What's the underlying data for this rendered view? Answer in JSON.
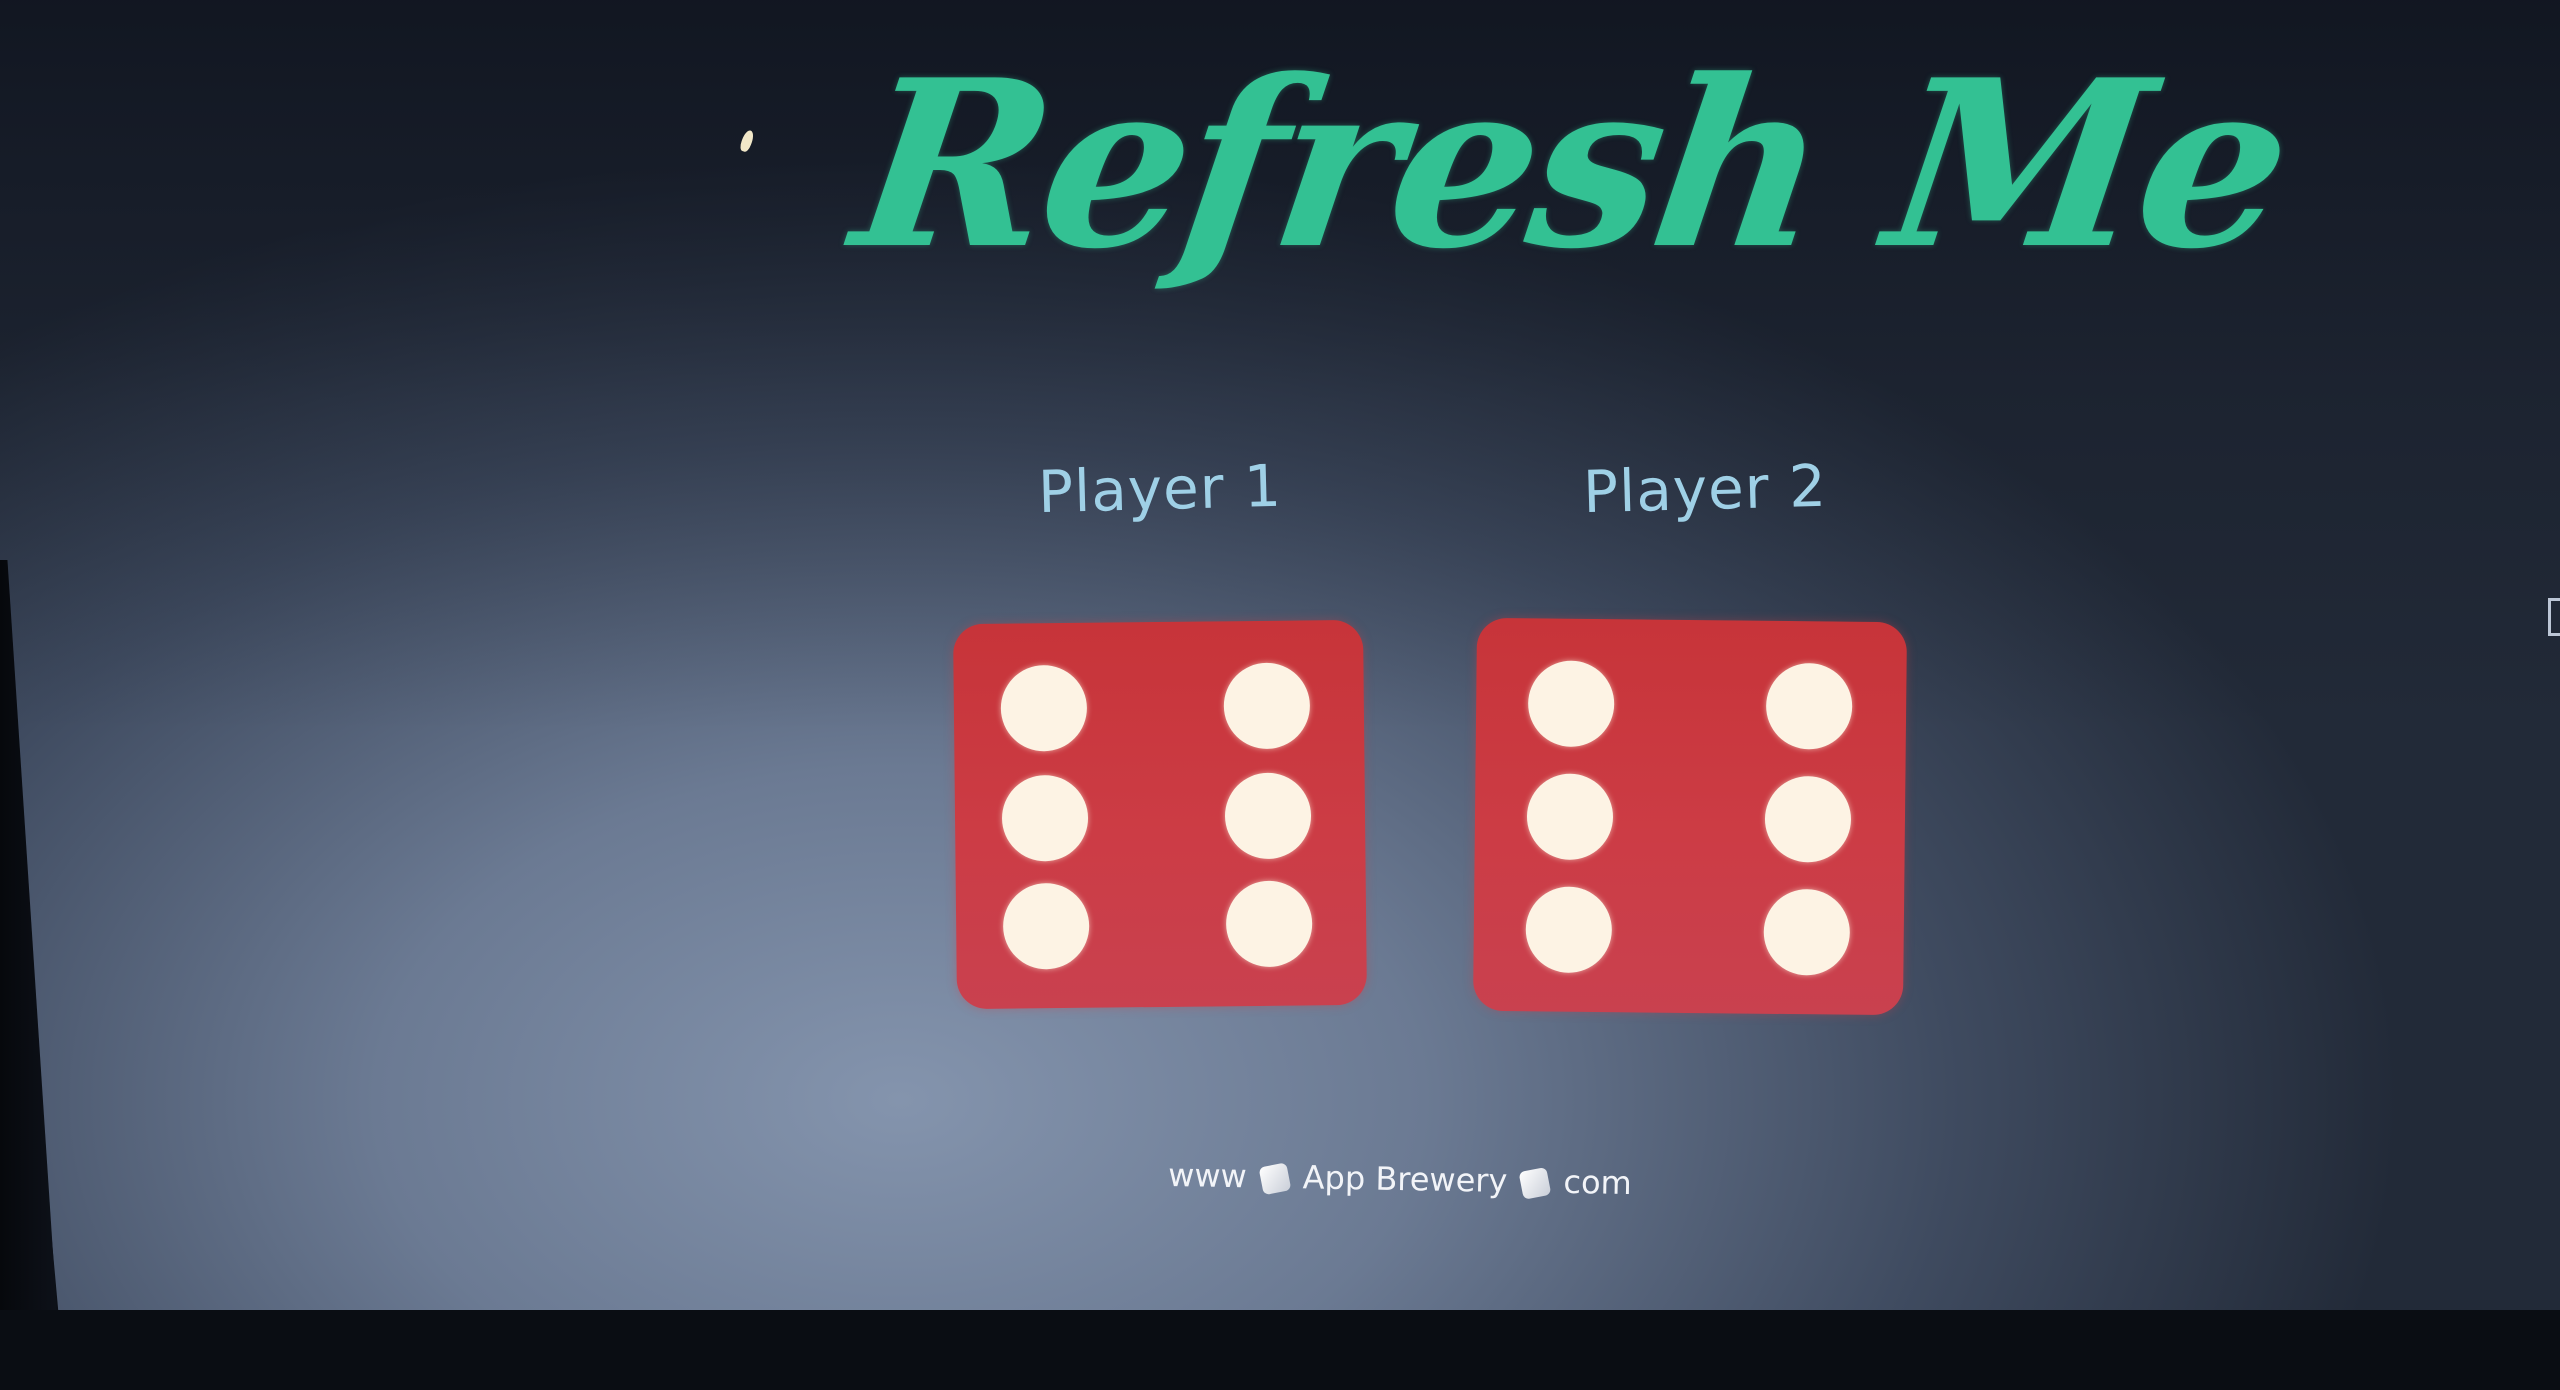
{
  "page": {
    "title": "Refresh Me"
  },
  "players": [
    {
      "label": "Player 1",
      "die_value": 6
    },
    {
      "label": "Player 2",
      "die_value": 6
    }
  ],
  "footer": {
    "part1": "www",
    "part2": "App Brewery",
    "part3": "com"
  },
  "colors": {
    "title": "#33c193",
    "player_label": "#9fd0e6",
    "die": "#c73439",
    "pip": "#fdf3e4",
    "background": "#6b7a93"
  }
}
